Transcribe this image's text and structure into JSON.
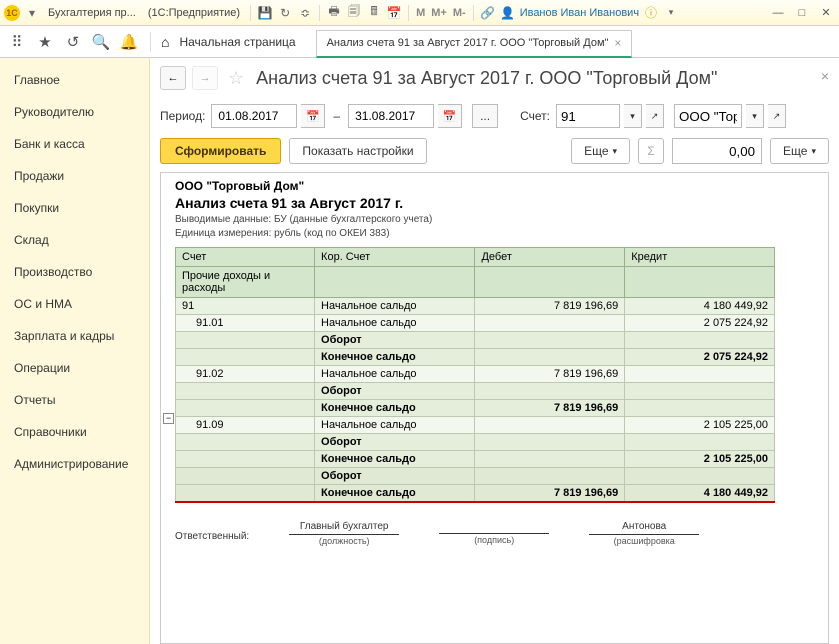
{
  "titlebar": {
    "app_title": "Бухгалтерия пр...",
    "platform": "(1С:Предприятие)",
    "user": "Иванов Иван Иванович"
  },
  "toolbar": {
    "home_label": "Начальная страница",
    "tab_label": "Анализ счета 91 за Август 2017 г. ООО \"Торговый Дом\""
  },
  "sidebar": {
    "items": [
      {
        "label": "Главное"
      },
      {
        "label": "Руководителю"
      },
      {
        "label": "Банк и касса"
      },
      {
        "label": "Продажи"
      },
      {
        "label": "Покупки"
      },
      {
        "label": "Склад"
      },
      {
        "label": "Производство"
      },
      {
        "label": "ОС и НМА"
      },
      {
        "label": "Зарплата и кадры"
      },
      {
        "label": "Операции"
      },
      {
        "label": "Отчеты"
      },
      {
        "label": "Справочники"
      },
      {
        "label": "Администрирование"
      }
    ]
  },
  "page": {
    "title": "Анализ счета 91 за Август 2017 г. ООО \"Торговый Дом\""
  },
  "filters": {
    "period_label": "Период:",
    "date_from": "01.08.2017",
    "date_to": "31.08.2017",
    "account_label": "Счет:",
    "account": "91",
    "org": "ООО \"Торг"
  },
  "actions": {
    "form": "Сформировать",
    "settings": "Показать настройки",
    "more": "Еще",
    "sum_value": "0,00"
  },
  "report": {
    "org": "ООО \"Торговый Дом\"",
    "title": "Анализ счета 91 за Август 2017 г.",
    "meta1_label": "Выводимые данные:",
    "meta1_val": "БУ (данные бухгалтерского учета)",
    "meta2_label": "Единица измерения:",
    "meta2_val": "рубль (код по ОКЕИ 383)",
    "cols": {
      "c1": "Счет",
      "c2": "Кор. Счет",
      "c3": "Дебет",
      "c4": "Кредит"
    },
    "subhead": "Прочие доходы и расходы",
    "rows": [
      {
        "acct": "91",
        "cor": "Начальное сальдо",
        "d": "7 819 196,69",
        "k": "4 180 449,92",
        "cls": "sub"
      },
      {
        "acct": "91.01",
        "cor": "Начальное сальдо",
        "d": "",
        "k": "2 075 224,92",
        "cls": ""
      },
      {
        "acct": "",
        "cor": "Оборот",
        "d": "",
        "k": "",
        "cls": "bold"
      },
      {
        "acct": "",
        "cor": "Конечное сальдо",
        "d": "",
        "k": "2 075 224,92",
        "cls": "bold"
      },
      {
        "acct": "91.02",
        "cor": "Начальное сальдо",
        "d": "7 819 196,69",
        "k": "",
        "cls": ""
      },
      {
        "acct": "",
        "cor": "Оборот",
        "d": "",
        "k": "",
        "cls": "bold"
      },
      {
        "acct": "",
        "cor": "Конечное сальдо",
        "d": "7 819 196,69",
        "k": "",
        "cls": "bold"
      },
      {
        "acct": "91.09",
        "cor": "Начальное сальдо",
        "d": "",
        "k": "2 105 225,00",
        "cls": ""
      },
      {
        "acct": "",
        "cor": "Оборот",
        "d": "",
        "k": "",
        "cls": "bold"
      },
      {
        "acct": "",
        "cor": "Конечное сальдо",
        "d": "",
        "k": "2 105 225,00",
        "cls": "bold"
      },
      {
        "acct": "",
        "cor": "Оборот",
        "d": "",
        "k": "",
        "cls": "total"
      },
      {
        "acct": "",
        "cor": "Конечное сальдо",
        "d": "7 819 196,69",
        "k": "4 180 449,92",
        "cls": "total red"
      }
    ],
    "sig": {
      "resp": "Ответственный:",
      "chief": "Главный бухгалтер",
      "pos": "(должность)",
      "sign": "(подпись)",
      "name": "Антонова",
      "decode": "(расшифровка"
    }
  }
}
